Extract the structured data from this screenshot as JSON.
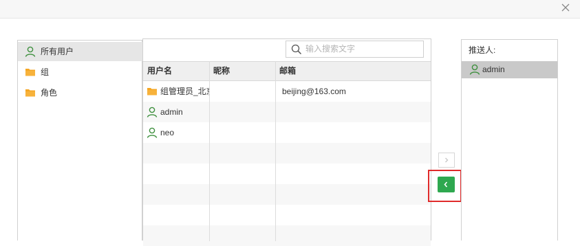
{
  "tree": {
    "items": [
      {
        "label": "所有用户",
        "icon": "user-icon"
      },
      {
        "label": "组",
        "icon": "folder-icon"
      },
      {
        "label": "角色",
        "icon": "folder-icon"
      }
    ]
  },
  "search": {
    "placeholder": "输入搜索文字",
    "value": ""
  },
  "table": {
    "columns": [
      "用户名",
      "昵称",
      "邮箱"
    ],
    "rows": [
      {
        "username": "组管理员_北京",
        "nickname": "",
        "email": "beijing@163.com",
        "icon": "folder-icon"
      },
      {
        "username": "admin",
        "nickname": "",
        "email": "",
        "icon": "user-icon"
      },
      {
        "username": "neo",
        "nickname": "",
        "email": "",
        "icon": "user-icon"
      }
    ]
  },
  "buttons": {
    "add_icon": "chevron-right-icon",
    "remove_icon": "chevron-left-icon"
  },
  "recipients": {
    "title": "推送人:",
    "items": [
      {
        "label": "admin",
        "icon": "user-icon"
      }
    ]
  },
  "colors": {
    "accent_green": "#2ea84f",
    "folder_orange": "#f5a623",
    "highlight_red": "#e02a2a",
    "user_green": "#3d8f3d"
  }
}
